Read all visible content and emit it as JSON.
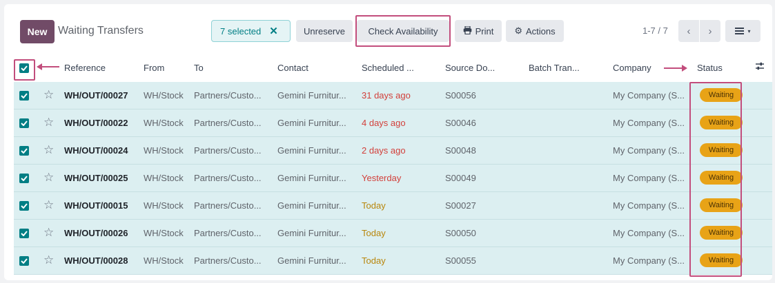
{
  "control_panel": {
    "new_label": "New",
    "view_title": "Waiting Transfers",
    "selected_label": "7 selected",
    "clear_icon": "x-icon",
    "unreserve_label": "Unreserve",
    "check_availability_label": "Check Availability",
    "print_label": "Print",
    "actions_label": "Actions",
    "pager_text": "1-7 / 7"
  },
  "columns": [
    "Reference",
    "From",
    "To",
    "Contact",
    "Scheduled ...",
    "Source Do...",
    "Batch Tran...",
    "Company",
    "Status"
  ],
  "rows": [
    {
      "reference": "WH/OUT/00027",
      "from": "WH/Stock",
      "to": "Partners/Custo...",
      "contact": "Gemini Furnitur...",
      "scheduled": "31 days ago",
      "scheduled_tone": "red",
      "source": "S00056",
      "batch": "",
      "company": "My Company (S...",
      "status": "Waiting"
    },
    {
      "reference": "WH/OUT/00022",
      "from": "WH/Stock",
      "to": "Partners/Custo...",
      "contact": "Gemini Furnitur...",
      "scheduled": "4 days ago",
      "scheduled_tone": "red",
      "source": "S00046",
      "batch": "",
      "company": "My Company (S...",
      "status": "Waiting"
    },
    {
      "reference": "WH/OUT/00024",
      "from": "WH/Stock",
      "to": "Partners/Custo...",
      "contact": "Gemini Furnitur...",
      "scheduled": "2 days ago",
      "scheduled_tone": "red",
      "source": "S00048",
      "batch": "",
      "company": "My Company (S...",
      "status": "Waiting"
    },
    {
      "reference": "WH/OUT/00025",
      "from": "WH/Stock",
      "to": "Partners/Custo...",
      "contact": "Gemini Furnitur...",
      "scheduled": "Yesterday",
      "scheduled_tone": "red",
      "source": "S00049",
      "batch": "",
      "company": "My Company (S...",
      "status": "Waiting"
    },
    {
      "reference": "WH/OUT/00015",
      "from": "WH/Stock",
      "to": "Partners/Custo...",
      "contact": "Gemini Furnitur...",
      "scheduled": "Today",
      "scheduled_tone": "amber",
      "source": "S00027",
      "batch": "",
      "company": "My Company (S...",
      "status": "Waiting"
    },
    {
      "reference": "WH/OUT/00026",
      "from": "WH/Stock",
      "to": "Partners/Custo...",
      "contact": "Gemini Furnitur...",
      "scheduled": "Today",
      "scheduled_tone": "amber",
      "source": "S00050",
      "batch": "",
      "company": "My Company (S...",
      "status": "Waiting"
    },
    {
      "reference": "WH/OUT/00028",
      "from": "WH/Stock",
      "to": "Partners/Custo...",
      "contact": "Gemini Furnitur...",
      "scheduled": "Today",
      "scheduled_tone": "amber",
      "source": "S00055",
      "batch": "",
      "company": "My Company (S...",
      "status": "Waiting"
    }
  ],
  "colors": {
    "brand": "#714b67",
    "accent": "#017e84",
    "annotation": "#c24d7c",
    "waiting_badge": "#e8a317",
    "overdue": "#d23f3a",
    "today": "#b8860b"
  }
}
